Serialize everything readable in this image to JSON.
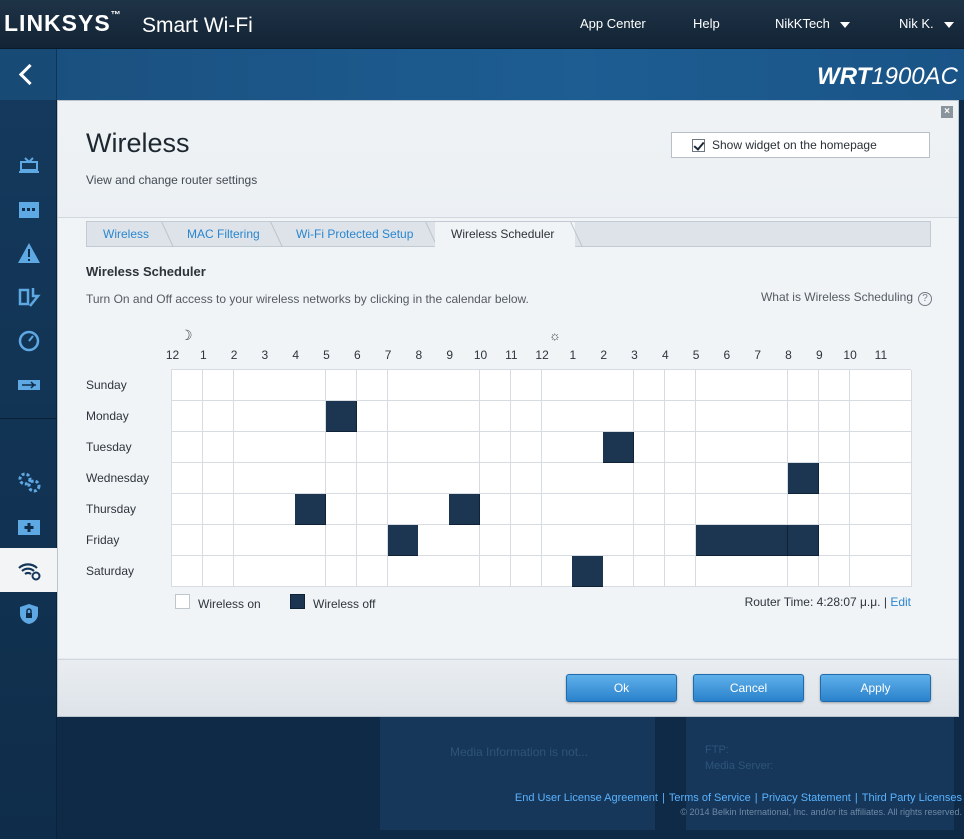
{
  "topbar": {
    "brand": "LINKSYS",
    "product": "Smart Wi-Fi",
    "nav": {
      "app_center": "App Center",
      "help": "Help",
      "account": "NikKTech",
      "user": "Nik K."
    }
  },
  "band": {
    "model_prefix": "WRT",
    "model_suffix": "1900AC"
  },
  "sidebar": {
    "items": [
      "device-list",
      "parental-controls",
      "alert-icon",
      "media-prioritization",
      "speed-test",
      "external-storage",
      "connectivity",
      "troubleshooting",
      "wireless",
      "security"
    ],
    "active": "wireless"
  },
  "modal": {
    "title": "Wireless",
    "subtitle": "View and change router settings",
    "widget_label": "Show widget on the homepage",
    "widget_checked": true,
    "tabs": [
      "Wireless",
      "MAC Filtering",
      "Wi-Fi Protected Setup",
      "Wireless Scheduler"
    ],
    "active_tab": "Wireless Scheduler",
    "scheduler": {
      "heading": "Wireless Scheduler",
      "description": "Turn On and Off access to your wireless networks by clicking in the calendar below.",
      "help_link": "What is Wireless Scheduling",
      "help_icon": "?",
      "moon_icon": "☽",
      "sun_icon": "☼",
      "hours": [
        "12",
        "1",
        "2",
        "3",
        "4",
        "5",
        "6",
        "7",
        "8",
        "9",
        "10",
        "11",
        "12",
        "1",
        "2",
        "3",
        "4",
        "5",
        "6",
        "7",
        "8",
        "9",
        "10",
        "11"
      ],
      "days": [
        "Sunday",
        "Monday",
        "Tuesday",
        "Wednesday",
        "Thursday",
        "Friday",
        "Saturday"
      ],
      "off_slots": {
        "Sunday": [],
        "Monday": [
          5
        ],
        "Tuesday": [
          14
        ],
        "Wednesday": [
          20
        ],
        "Thursday": [
          4,
          9
        ],
        "Friday": [
          7,
          17,
          18,
          19,
          20
        ],
        "Saturday": [
          13
        ]
      },
      "legend_on": "Wireless on",
      "legend_off": "Wireless off",
      "router_time_label": "Router Time:",
      "router_time_value": "4:28:07 μ.μ.",
      "edit_link": "Edit"
    },
    "buttons": {
      "ok": "Ok",
      "cancel": "Cancel",
      "apply": "Apply"
    }
  },
  "background": {
    "left_text": "Media Information is not...",
    "right_lines": [
      "FTP:",
      "Media Server:"
    ]
  },
  "footer": {
    "links": [
      "End User License Agreement",
      "Terms of Service",
      "Privacy Statement",
      "Third Party Licenses"
    ],
    "copyright": "© 2014 Belkin International, Inc. and/or its affiliates. All rights reserved."
  },
  "colors": {
    "off_cell": "#1c3550",
    "accent": "#2a86d0",
    "button": "#3b94da"
  }
}
